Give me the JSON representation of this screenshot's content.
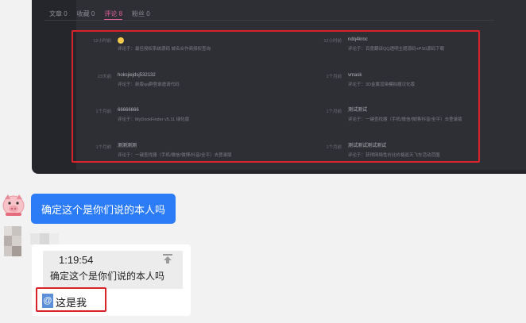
{
  "screenshot": {
    "tabs": [
      {
        "label": "文章 0"
      },
      {
        "label": "收藏 0"
      },
      {
        "label": "评论 8"
      },
      {
        "label": "粉丝 0"
      }
    ],
    "comments": [
      {
        "time": "12小时前",
        "name": "😀",
        "prefix": "评论于：",
        "text": "最佳授权系统源码 城名合作商授权查询"
      },
      {
        "time": "12小时前",
        "name": "ndq4kroc",
        "prefix": "评论于：",
        "text": "百度翻译QQ透明主题源码+PS0源码下载"
      },
      {
        "time": "23天前",
        "name": "hoksjiejdsj532132",
        "prefix": "评论于：",
        "text": "新版qq群登录邀请代码"
      },
      {
        "time": "1个月前",
        "name": "vmask",
        "prefix": "评论于：",
        "text": "3D金属渲染模拟器汉化版"
      },
      {
        "time": "1个月前",
        "name": "66666666",
        "prefix": "评论于：",
        "text": "MyDockFinder v5.11 绿化版"
      },
      {
        "time": "1个月前",
        "name": "测试测试",
        "prefix": "评论于：",
        "text": "一键查找器（手机/微信/微博/抖音/全平）去登录版"
      },
      {
        "time": "1个月前",
        "name": "测测测测",
        "prefix": "评论于：",
        "text": "一键查找器（手机/微信/微博/抖音/全平）去登录版"
      },
      {
        "time": "1个月前",
        "name": "测试测试测试测试",
        "prefix": "评论于：",
        "text": "获得网络性价比价格巡天飞车活动范围"
      }
    ]
  },
  "chat": {
    "message_blue": "确定这个是你们说的本人吗",
    "quote_time": "1:19:54",
    "quote_text": "确定这个是你们说的本人吗",
    "at_symbol": "@",
    "reply_text": "这是我"
  }
}
